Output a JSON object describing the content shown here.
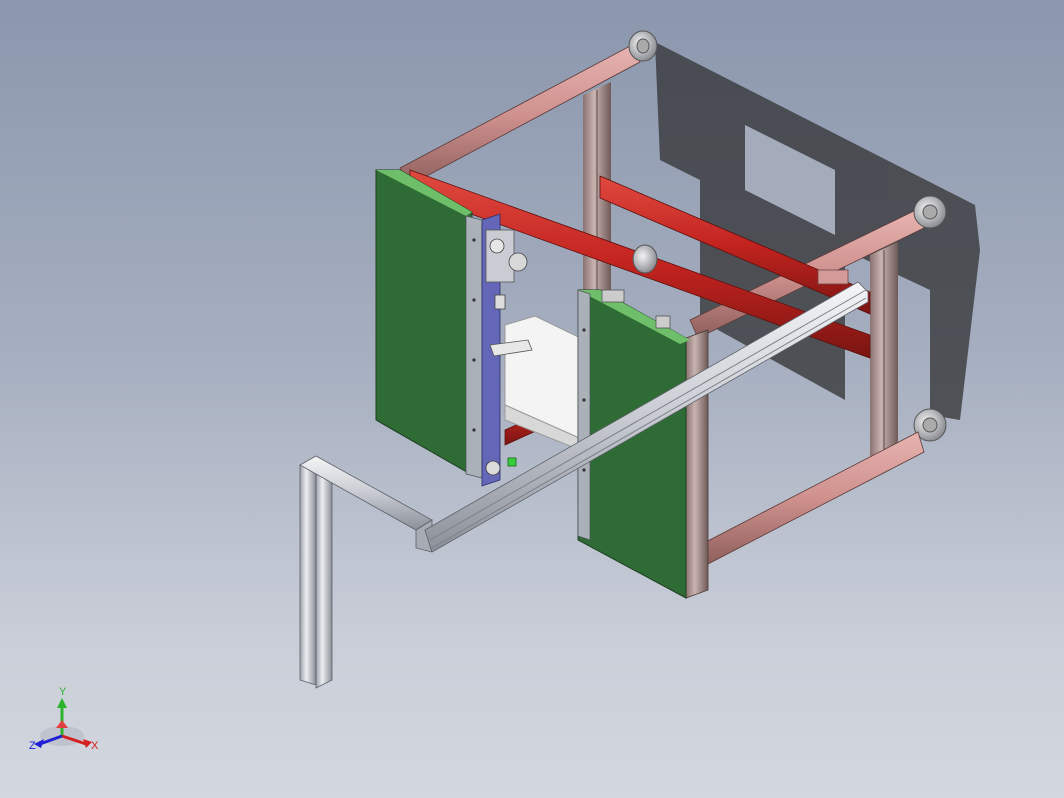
{
  "viewport": {
    "background_top": "#8b97ad",
    "background_bottom": "#d3d7de"
  },
  "model": {
    "panel_color": "#2f6b34",
    "panel_edge_color": "#6fbf6a",
    "frame_red_color": "#c3231f",
    "frame_pink_color": "#d49a98",
    "aluminum_color": "#c9ccd3",
    "rail_blue_color": "#6467b8",
    "box_color": "#f2f2f2"
  },
  "triad": {
    "x_label": "X",
    "y_label": "Y",
    "z_label": "Z",
    "x_color": "#d42020",
    "y_color": "#2bb32b",
    "z_color": "#2020d4"
  }
}
